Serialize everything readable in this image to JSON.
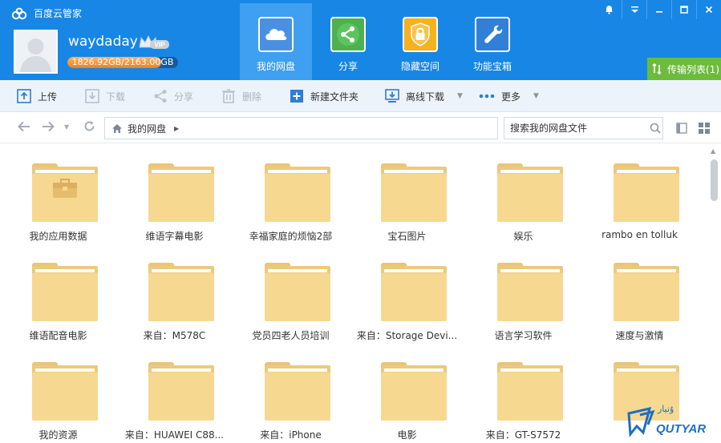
{
  "app": {
    "title": "百度云管家",
    "logo_icon": "cloud-logo-icon"
  },
  "window_controls": [
    {
      "name": "notification-button",
      "glyph": "🔔"
    },
    {
      "name": "menu-button",
      "glyph": "▾"
    },
    {
      "name": "minimize-button",
      "glyph": "—"
    },
    {
      "name": "maximize-button",
      "glyph": "☐"
    },
    {
      "name": "close-button",
      "glyph": "✕"
    }
  ],
  "user": {
    "username": "waydaday",
    "vip_badge": "VIP",
    "quota_text": "1826.92GB/2163.00GB",
    "quota_used_fraction": 0.845
  },
  "nav_tabs": [
    {
      "label": "我的网盘",
      "icon": "cloud-icon",
      "active": true,
      "color": "#4a90e2"
    },
    {
      "label": "分享",
      "icon": "share-icon",
      "active": false,
      "color": "#4db14f"
    },
    {
      "label": "隐藏空间",
      "icon": "lock-shield-icon",
      "active": false,
      "color": "#f5b21e"
    },
    {
      "label": "功能宝箱",
      "icon": "wrench-icon",
      "active": false,
      "color": "#2f80d6"
    }
  ],
  "transfer": {
    "label": "传输列表(1)"
  },
  "toolbar": {
    "upload": "上传",
    "download": "下载",
    "share": "分享",
    "delete": "删除",
    "new_folder": "新建文件夹",
    "offline_download": "离线下载",
    "more": "更多"
  },
  "breadcrumb": {
    "root": "我的网盘"
  },
  "search": {
    "placeholder": "搜索我的网盘文件"
  },
  "files": [
    {
      "name": "我的应用数据",
      "type": "app-folder"
    },
    {
      "name": "维语字幕电影",
      "type": "folder"
    },
    {
      "name": "幸福家庭的烦恼2部",
      "type": "folder"
    },
    {
      "name": "宝石图片",
      "type": "folder"
    },
    {
      "name": "娱乐",
      "type": "folder"
    },
    {
      "name": "rambo en tolluk",
      "type": "folder"
    },
    {
      "name": "维语配音电影",
      "type": "folder"
    },
    {
      "name": "来自：M578C",
      "type": "folder"
    },
    {
      "name": "党员四老人员培训",
      "type": "folder"
    },
    {
      "name": "来自：Storage Devi...",
      "type": "folder"
    },
    {
      "name": "语言学习软件",
      "type": "folder"
    },
    {
      "name": "速度与激情",
      "type": "folder"
    },
    {
      "name": "我的资源",
      "type": "folder"
    },
    {
      "name": "来自：HUAWEI C88...",
      "type": "folder"
    },
    {
      "name": "来自：iPhone",
      "type": "folder"
    },
    {
      "name": "电影",
      "type": "folder"
    },
    {
      "name": "来自：GT-S7572",
      "type": "folder"
    },
    {
      "name": "",
      "type": "folder"
    }
  ],
  "colors": {
    "header_blue": "#1886e5",
    "active_tab": "#3f9ff0",
    "transfer_green": "#6dbb3c",
    "folder_yellow": "#f6d891"
  },
  "watermark": {
    "text": "QUTYAR"
  }
}
